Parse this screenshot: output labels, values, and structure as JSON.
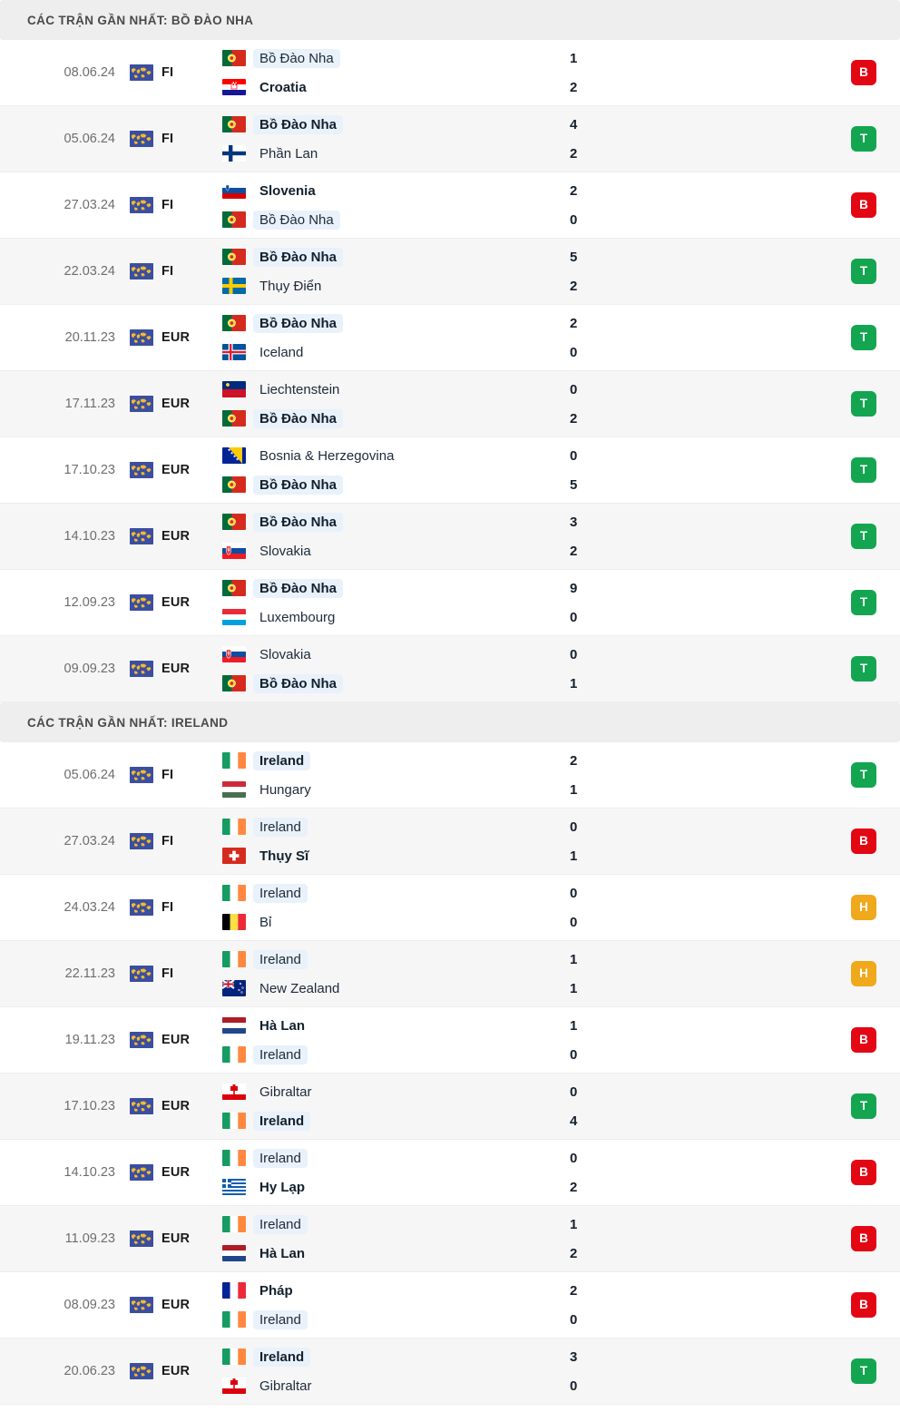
{
  "sections": [
    {
      "header": "CÁC TRẬN GẦN NHẤT: BỒ ĐÀO NHA",
      "matches": [
        {
          "date": "08.06.24",
          "competition": "FI",
          "home": {
            "name": "Bồ Đào Nha",
            "flag": "pt",
            "bold": false,
            "focus": true
          },
          "away": {
            "name": "Croatia",
            "flag": "hr",
            "bold": true,
            "focus": false
          },
          "home_score": "1",
          "away_score": "2",
          "result": "B",
          "result_type": "loss"
        },
        {
          "date": "05.06.24",
          "competition": "FI",
          "home": {
            "name": "Bồ Đào Nha",
            "flag": "pt",
            "bold": true,
            "focus": true
          },
          "away": {
            "name": "Phần Lan",
            "flag": "fi",
            "bold": false,
            "focus": false
          },
          "home_score": "4",
          "away_score": "2",
          "result": "T",
          "result_type": "win"
        },
        {
          "date": "27.03.24",
          "competition": "FI",
          "home": {
            "name": "Slovenia",
            "flag": "si",
            "bold": true,
            "focus": false
          },
          "away": {
            "name": "Bồ Đào Nha",
            "flag": "pt",
            "bold": false,
            "focus": true
          },
          "home_score": "2",
          "away_score": "0",
          "result": "B",
          "result_type": "loss"
        },
        {
          "date": "22.03.24",
          "competition": "FI",
          "home": {
            "name": "Bồ Đào Nha",
            "flag": "pt",
            "bold": true,
            "focus": true
          },
          "away": {
            "name": "Thụy Điển",
            "flag": "se",
            "bold": false,
            "focus": false
          },
          "home_score": "5",
          "away_score": "2",
          "result": "T",
          "result_type": "win"
        },
        {
          "date": "20.11.23",
          "competition": "EUR",
          "home": {
            "name": "Bồ Đào Nha",
            "flag": "pt",
            "bold": true,
            "focus": true
          },
          "away": {
            "name": "Iceland",
            "flag": "is",
            "bold": false,
            "focus": false
          },
          "home_score": "2",
          "away_score": "0",
          "result": "T",
          "result_type": "win"
        },
        {
          "date": "17.11.23",
          "competition": "EUR",
          "home": {
            "name": "Liechtenstein",
            "flag": "li",
            "bold": false,
            "focus": false
          },
          "away": {
            "name": "Bồ Đào Nha",
            "flag": "pt",
            "bold": true,
            "focus": true
          },
          "home_score": "0",
          "away_score": "2",
          "result": "T",
          "result_type": "win"
        },
        {
          "date": "17.10.23",
          "competition": "EUR",
          "home": {
            "name": "Bosnia & Herzegovina",
            "flag": "ba",
            "bold": false,
            "focus": false
          },
          "away": {
            "name": "Bồ Đào Nha",
            "flag": "pt",
            "bold": true,
            "focus": true
          },
          "home_score": "0",
          "away_score": "5",
          "result": "T",
          "result_type": "win"
        },
        {
          "date": "14.10.23",
          "competition": "EUR",
          "home": {
            "name": "Bồ Đào Nha",
            "flag": "pt",
            "bold": true,
            "focus": true
          },
          "away": {
            "name": "Slovakia",
            "flag": "sk",
            "bold": false,
            "focus": false
          },
          "home_score": "3",
          "away_score": "2",
          "result": "T",
          "result_type": "win"
        },
        {
          "date": "12.09.23",
          "competition": "EUR",
          "home": {
            "name": "Bồ Đào Nha",
            "flag": "pt",
            "bold": true,
            "focus": true
          },
          "away": {
            "name": "Luxembourg",
            "flag": "lu",
            "bold": false,
            "focus": false
          },
          "home_score": "9",
          "away_score": "0",
          "result": "T",
          "result_type": "win"
        },
        {
          "date": "09.09.23",
          "competition": "EUR",
          "home": {
            "name": "Slovakia",
            "flag": "sk",
            "bold": false,
            "focus": false
          },
          "away": {
            "name": "Bồ Đào Nha",
            "flag": "pt",
            "bold": true,
            "focus": true
          },
          "home_score": "0",
          "away_score": "1",
          "result": "T",
          "result_type": "win"
        }
      ]
    },
    {
      "header": "CÁC TRẬN GẦN NHẤT: IRELAND",
      "matches": [
        {
          "date": "05.06.24",
          "competition": "FI",
          "home": {
            "name": "Ireland",
            "flag": "ie",
            "bold": true,
            "focus": true
          },
          "away": {
            "name": "Hungary",
            "flag": "hu",
            "bold": false,
            "focus": false
          },
          "home_score": "2",
          "away_score": "1",
          "result": "T",
          "result_type": "win"
        },
        {
          "date": "27.03.24",
          "competition": "FI",
          "home": {
            "name": "Ireland",
            "flag": "ie",
            "bold": false,
            "focus": true
          },
          "away": {
            "name": "Thụy Sĩ",
            "flag": "ch",
            "bold": true,
            "focus": false
          },
          "home_score": "0",
          "away_score": "1",
          "result": "B",
          "result_type": "loss"
        },
        {
          "date": "24.03.24",
          "competition": "FI",
          "home": {
            "name": "Ireland",
            "flag": "ie",
            "bold": false,
            "focus": true
          },
          "away": {
            "name": "Bỉ",
            "flag": "be",
            "bold": false,
            "focus": false
          },
          "home_score": "0",
          "away_score": "0",
          "result": "H",
          "result_type": "draw"
        },
        {
          "date": "22.11.23",
          "competition": "FI",
          "home": {
            "name": "Ireland",
            "flag": "ie",
            "bold": false,
            "focus": true
          },
          "away": {
            "name": "New Zealand",
            "flag": "nz",
            "bold": false,
            "focus": false
          },
          "home_score": "1",
          "away_score": "1",
          "result": "H",
          "result_type": "draw"
        },
        {
          "date": "19.11.23",
          "competition": "EUR",
          "home": {
            "name": "Hà Lan",
            "flag": "nl",
            "bold": true,
            "focus": false
          },
          "away": {
            "name": "Ireland",
            "flag": "ie",
            "bold": false,
            "focus": true
          },
          "home_score": "1",
          "away_score": "0",
          "result": "B",
          "result_type": "loss"
        },
        {
          "date": "17.10.23",
          "competition": "EUR",
          "home": {
            "name": "Gibraltar",
            "flag": "gi",
            "bold": false,
            "focus": false
          },
          "away": {
            "name": "Ireland",
            "flag": "ie",
            "bold": true,
            "focus": true
          },
          "home_score": "0",
          "away_score": "4",
          "result": "T",
          "result_type": "win"
        },
        {
          "date": "14.10.23",
          "competition": "EUR",
          "home": {
            "name": "Ireland",
            "flag": "ie",
            "bold": false,
            "focus": true
          },
          "away": {
            "name": "Hy Lạp",
            "flag": "gr",
            "bold": true,
            "focus": false
          },
          "home_score": "0",
          "away_score": "2",
          "result": "B",
          "result_type": "loss"
        },
        {
          "date": "11.09.23",
          "competition": "EUR",
          "home": {
            "name": "Ireland",
            "flag": "ie",
            "bold": false,
            "focus": true
          },
          "away": {
            "name": "Hà Lan",
            "flag": "nl",
            "bold": true,
            "focus": false
          },
          "home_score": "1",
          "away_score": "2",
          "result": "B",
          "result_type": "loss"
        },
        {
          "date": "08.09.23",
          "competition": "EUR",
          "home": {
            "name": "Pháp",
            "flag": "fr",
            "bold": true,
            "focus": false
          },
          "away": {
            "name": "Ireland",
            "flag": "ie",
            "bold": false,
            "focus": true
          },
          "home_score": "2",
          "away_score": "0",
          "result": "B",
          "result_type": "loss"
        },
        {
          "date": "20.06.23",
          "competition": "EUR",
          "home": {
            "name": "Ireland",
            "flag": "ie",
            "bold": true,
            "focus": true
          },
          "away": {
            "name": "Gibraltar",
            "flag": "gi",
            "bold": false,
            "focus": false
          },
          "home_score": "3",
          "away_score": "0",
          "result": "T",
          "result_type": "win"
        }
      ]
    }
  ],
  "icons": {
    "competition_icon": "world-map-icon"
  },
  "colors": {
    "win": "#13a550",
    "loss": "#e30613",
    "draw": "#f0a81c",
    "header_bg": "#eeeeee",
    "focus_pill": "#e9f1fb",
    "alt_row": "#f6f6f6"
  }
}
